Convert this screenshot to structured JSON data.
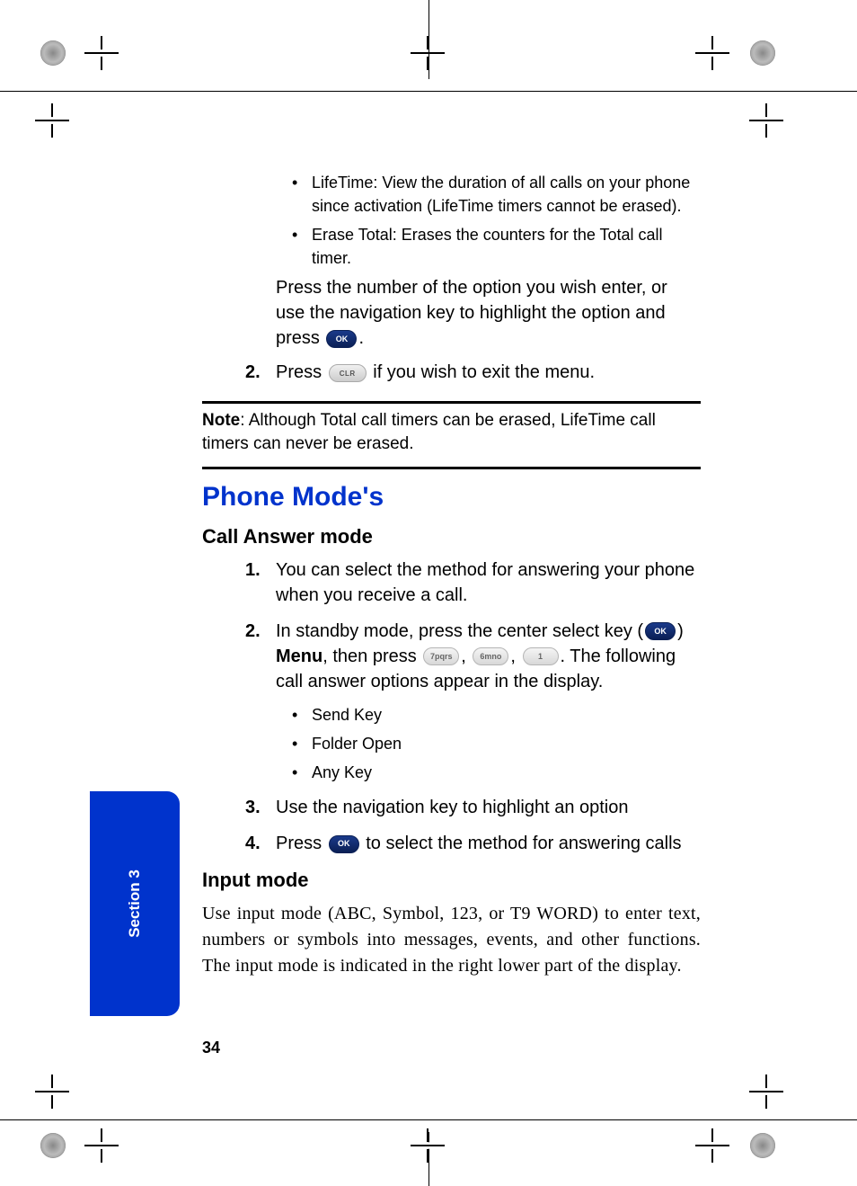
{
  "top_bullets": [
    "LifeTime: View the duration of all calls on your phone since activation (LifeTime timers cannot be erased).",
    "Erase Total: Erases the counters for the Total call timer."
  ],
  "press_option_text_a": "Press the number of the option you wish enter, or use the navigation key to highlight the option and press ",
  "press_option_text_b": ".",
  "step2_a": "Press ",
  "step2_b": " if you wish to exit the menu.",
  "note_label": "Note",
  "note_text": ": Although Total call timers can be erased, LifeTime call timers can never be erased.",
  "section_title": "Phone Mode's",
  "call_answer_heading": "Call Answer mode",
  "call_steps": {
    "1": "You can select the method for answering your phone when you receive a call.",
    "2a": "In standby mode, press the center select key (",
    "2b": ") ",
    "2_menu": "Menu",
    "2c": ", then press ",
    "2d": ", ",
    "2e": ", ",
    "2f": ". The following call answer options appear in the display.",
    "3": "Use the navigation key to highlight an option",
    "4a": "Press ",
    "4b": " to select the method for answering calls"
  },
  "call_sub_bullets": [
    "Send Key",
    "Folder Open",
    "Any Key"
  ],
  "input_mode_heading": "Input mode",
  "input_mode_body": "Use input mode (ABC, Symbol, 123, or T9 WORD) to enter text, numbers or symbols into messages, events, and other functions. The input mode is indicated in the right lower part of the display.",
  "sidebar_label": "Section 3",
  "page_number": "34",
  "keys": {
    "ok": "OK",
    "clr": "CLR",
    "k7": "7pqrs",
    "k6": "6mno",
    "k1": "1"
  }
}
